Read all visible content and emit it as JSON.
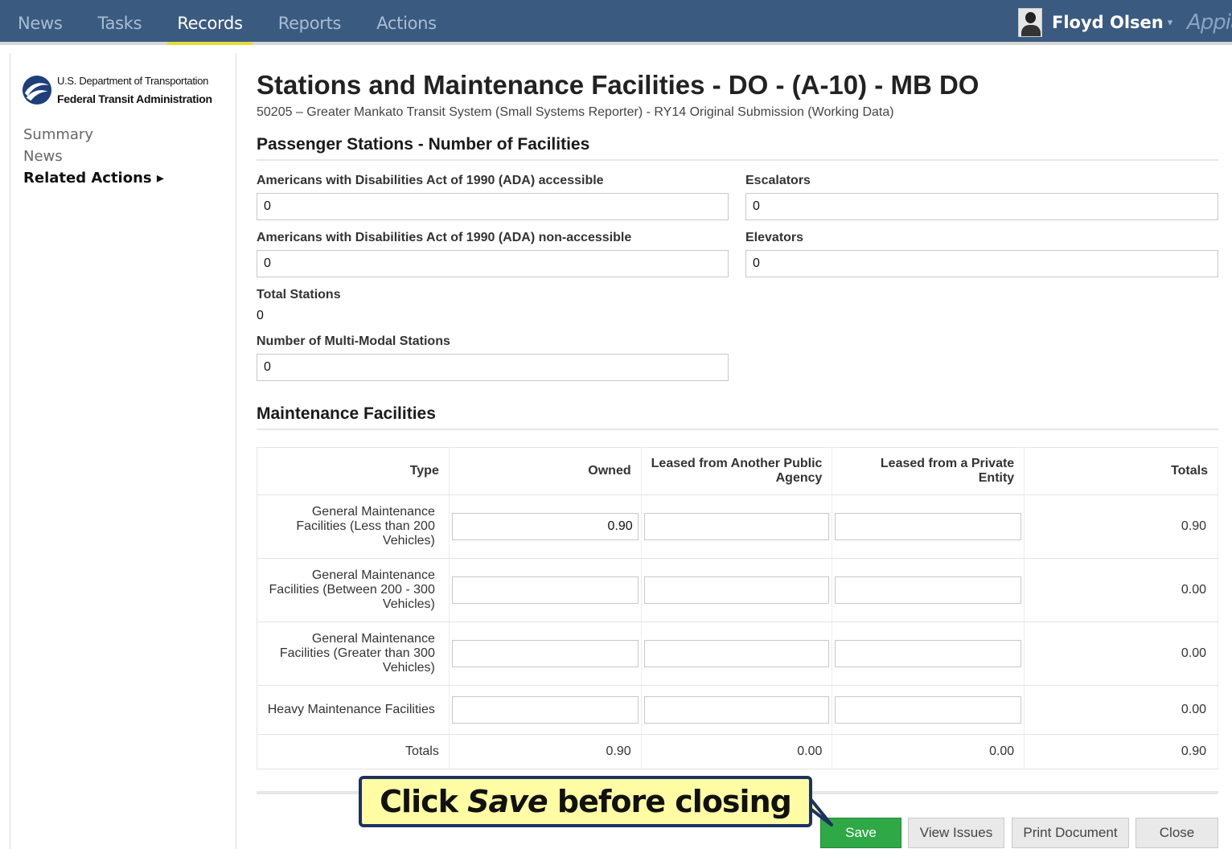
{
  "topnav": {
    "items": [
      {
        "label": "News"
      },
      {
        "label": "Tasks"
      },
      {
        "label": "Records"
      },
      {
        "label": "Reports"
      },
      {
        "label": "Actions"
      }
    ],
    "active": "Records",
    "user_name": "Floyd Olsen",
    "user_caret": "▾",
    "brand": "Appian"
  },
  "sidebar": {
    "org_line1": "U.S. Department of Transportation",
    "org_line2": "Federal Transit Administration",
    "items": [
      {
        "label": "Summary"
      },
      {
        "label": "News"
      },
      {
        "label": "Related Actions ▸"
      }
    ]
  },
  "header": {
    "title": "Stations and Maintenance Facilities - DO - (A-10) - MB DO",
    "subtitle": "50205 – Greater Mankato Transit System (Small Systems Reporter) - RY14 Original Submission (Working Data)"
  },
  "passenger": {
    "section_title": "Passenger Stations - Number of Facilities",
    "ada_accessible_label": "Americans with Disabilities Act of 1990 (ADA) accessible",
    "ada_accessible_value": "0",
    "escalators_label": "Escalators",
    "escalators_value": "0",
    "ada_non_label": "Americans with Disabilities Act of 1990 (ADA) non-accessible",
    "ada_non_value": "0",
    "elevators_label": "Elevators",
    "elevators_value": "0",
    "total_label": "Total Stations",
    "total_value": "0",
    "multimodal_label": "Number of Multi-Modal Stations",
    "multimodal_value": "0"
  },
  "maintenance": {
    "section_title": "Maintenance Facilities",
    "columns": [
      "Type",
      "Owned",
      "Leased from Another Public Agency",
      "Leased from a Private Entity",
      "Totals"
    ],
    "rows": [
      {
        "type": "General Maintenance Facilities (Less than 200 Vehicles)",
        "owned": "0.90",
        "public": "",
        "private": "",
        "total": "0.90"
      },
      {
        "type": "General Maintenance Facilities (Between 200 - 300 Vehicles)",
        "owned": "",
        "public": "",
        "private": "",
        "total": "0.00"
      },
      {
        "type": "General Maintenance Facilities (Greater than 300 Vehicles)",
        "owned": "",
        "public": "",
        "private": "",
        "total": "0.00"
      },
      {
        "type": "Heavy Maintenance Facilities",
        "owned": "",
        "public": "",
        "private": "",
        "total": "0.00"
      }
    ],
    "totals": {
      "label": "Totals",
      "owned": "0.90",
      "public": "0.00",
      "private": "0.00",
      "total": "0.90"
    }
  },
  "buttons": {
    "save": "Save",
    "view_issues": "View Issues",
    "print": "Print Document",
    "close": "Close"
  },
  "callout": {
    "pre": "Click ",
    "em": "Save",
    "post": " before closing",
    "background": "#fffca3",
    "border": "#1d3260"
  },
  "colors": {
    "topbar": "#3a5a80",
    "active_underline": "#e8dc3c",
    "save_button": "#2fa846"
  }
}
